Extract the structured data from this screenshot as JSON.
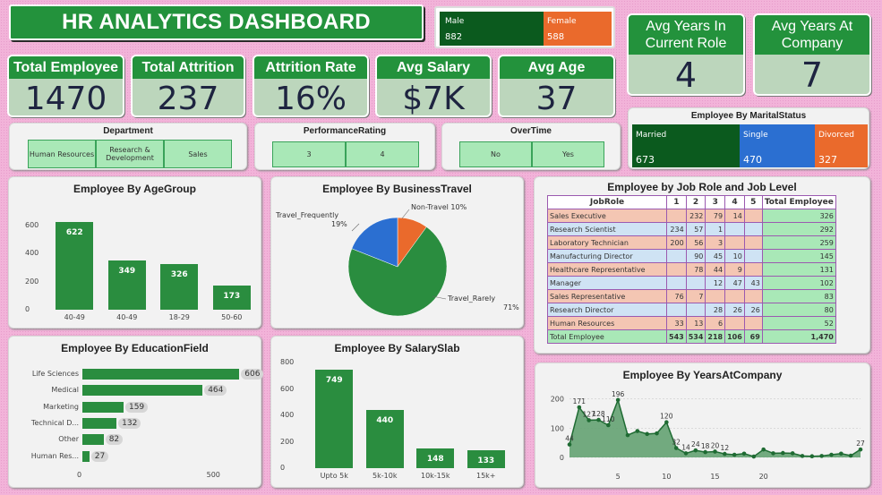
{
  "header": {
    "title": "HR ANALYTICS DASHBOARD"
  },
  "gender": {
    "male_label": "Male",
    "male_value": "882",
    "female_label": "Female",
    "female_value": "588"
  },
  "kpis": {
    "total_employee": {
      "label": "Total Employee",
      "value": "1470"
    },
    "total_attrition": {
      "label": "Total Attrition",
      "value": "237"
    },
    "attrition_rate": {
      "label": "Attrition Rate",
      "value": "16%"
    },
    "avg_salary": {
      "label": "Avg Salary",
      "value": "$7K"
    },
    "avg_age": {
      "label": "Avg Age",
      "value": "37"
    },
    "avg_years_role": {
      "label1": "Avg Years In",
      "label2": "Current Role",
      "value": "4"
    },
    "avg_years_company": {
      "label1": "Avg Years At",
      "label2": "Company",
      "value": "7"
    }
  },
  "slicers": {
    "department": {
      "title": "Department",
      "options": [
        "Human Resources",
        "Research & Development",
        "Sales"
      ]
    },
    "performance": {
      "title": "PerformanceRating",
      "options": [
        "3",
        "4"
      ]
    },
    "overtime": {
      "title": "OverTime",
      "options": [
        "No",
        "Yes"
      ]
    }
  },
  "marital": {
    "title": "Employee By MaritalStatus",
    "items": [
      {
        "label": "Married",
        "value": "673",
        "color": "#0b5a1e"
      },
      {
        "label": "Single",
        "value": "470",
        "color": "#2b6fd1"
      },
      {
        "label": "Divorced",
        "value": "327",
        "color": "#ea6a2c"
      }
    ]
  },
  "colors": {
    "green": "#2a8d3f",
    "blue": "#2b6fd1",
    "orange": "#ea6a2c",
    "dark_green": "#0b5a1e"
  },
  "age_title": "Employee By AgeGroup",
  "travel_title": "Employee By BusinessTravel",
  "education_title": "Employee By EducationField",
  "salary_title": "Employee By SalarySlab",
  "jobrole_title": "Employee by Job Role and Job Level",
  "years_title": "Employee By YearsAtCompany",
  "chart_data": [
    {
      "type": "bar",
      "title": "Employee By AgeGroup",
      "categories": [
        "40-49",
        "40-49",
        "18-29",
        "50-60"
      ],
      "values": [
        622,
        349,
        326,
        173
      ],
      "ylim": [
        0,
        700
      ],
      "yticks": [
        0,
        200,
        400,
        600
      ]
    },
    {
      "type": "pie",
      "title": "Employee By BusinessTravel",
      "labels": [
        "Travel_Rarely",
        "Travel_Frequently",
        "Non-Travel"
      ],
      "values": [
        71,
        19,
        10
      ],
      "label_texts": [
        "Travel_Rarely 71%",
        "Travel_Frequently 19%",
        "Non-Travel 10%"
      ],
      "colors": [
        "#2a8d3f",
        "#2b6fd1",
        "#ea6a2c"
      ]
    },
    {
      "type": "bar",
      "orientation": "horizontal",
      "title": "Employee By EducationField",
      "categories": [
        "Life Sciences",
        "Medical",
        "Marketing",
        "Technical D...",
        "Other",
        "Human Res..."
      ],
      "values": [
        606,
        464,
        159,
        132,
        82,
        27
      ],
      "xlim": [
        0,
        650
      ],
      "xticks": [
        0,
        500
      ]
    },
    {
      "type": "bar",
      "title": "Employee By SalarySlab",
      "categories": [
        "Upto 5k",
        "5k-10k",
        "10k-15k",
        "15k+"
      ],
      "values": [
        749,
        440,
        148,
        133
      ],
      "ylim": [
        0,
        800
      ],
      "yticks": [
        0,
        200,
        400,
        600,
        800
      ]
    },
    {
      "type": "table",
      "title": "Employee by Job Role and Job Level",
      "columns": [
        "JobRole",
        "1",
        "2",
        "3",
        "4",
        "5",
        "Total Employee"
      ],
      "rows": [
        [
          "Sales Executive",
          "",
          "232",
          "79",
          "14",
          "",
          "326"
        ],
        [
          "Research Scientist",
          "234",
          "57",
          "1",
          "",
          "",
          "292"
        ],
        [
          "Laboratory Technician",
          "200",
          "56",
          "3",
          "",
          "",
          "259"
        ],
        [
          "Manufacturing Director",
          "",
          "90",
          "45",
          "10",
          "",
          "145"
        ],
        [
          "Healthcare Representative",
          "",
          "78",
          "44",
          "9",
          "",
          "131"
        ],
        [
          "Manager",
          "",
          "",
          "12",
          "47",
          "43",
          "102"
        ],
        [
          "Sales Representative",
          "76",
          "7",
          "",
          "",
          "",
          "83"
        ],
        [
          "Research Director",
          "",
          "",
          "28",
          "26",
          "26",
          "80"
        ],
        [
          "Human Resources",
          "33",
          "13",
          "6",
          "",
          "",
          "52"
        ]
      ],
      "total": [
        "Total Employee",
        "543",
        "534",
        "218",
        "106",
        "69",
        "1,470"
      ]
    },
    {
      "type": "area",
      "title": "Employee By YearsAtCompany",
      "x": [
        0,
        1,
        2,
        3,
        4,
        5,
        6,
        7,
        8,
        9,
        10,
        11,
        12,
        13,
        14,
        15,
        16,
        17,
        18,
        19,
        20,
        21,
        22,
        23,
        24,
        25,
        26,
        27,
        28,
        29,
        30
      ],
      "y": [
        44,
        171,
        127,
        128,
        110,
        196,
        76,
        90,
        80,
        82,
        120,
        32,
        14,
        24,
        18,
        20,
        12,
        9,
        13,
        3,
        27,
        14,
        15,
        14,
        5,
        4,
        5,
        9,
        13,
        6,
        27
      ],
      "point_labels": {
        "0": "44",
        "1": "171",
        "2": "127",
        "3": "128",
        "4": "110",
        "5": "196",
        "10": "120",
        "11": "32",
        "12": "14",
        "13": "24",
        "14": "18",
        "15": "20",
        "16": "12",
        "30": "27"
      },
      "ylim": [
        0,
        220
      ],
      "yticks": [
        0,
        100,
        200
      ],
      "xticks": [
        5,
        10,
        15,
        20
      ]
    }
  ]
}
